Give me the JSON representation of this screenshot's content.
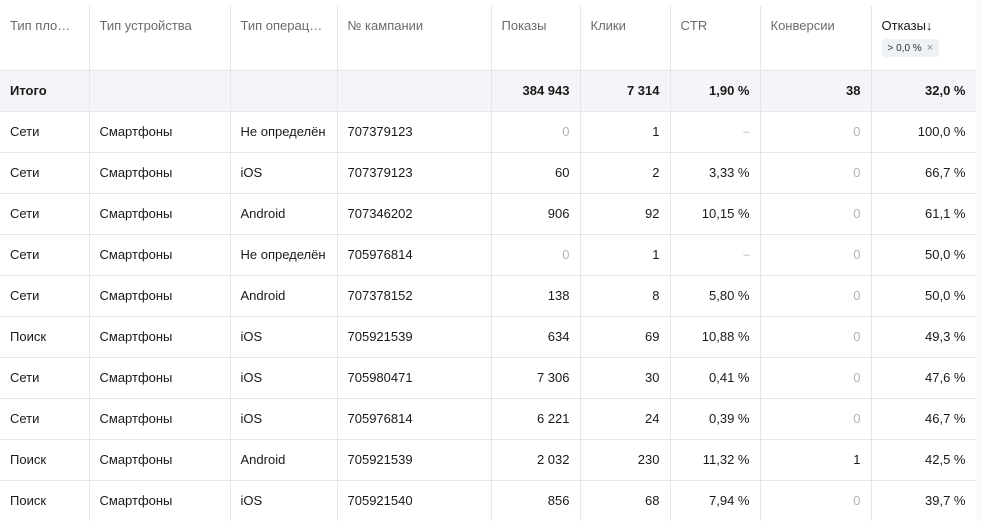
{
  "columns": [
    {
      "label": "Тип площ…"
    },
    {
      "label": "Тип устройства"
    },
    {
      "label": "Тип операци…"
    },
    {
      "label": "№ кампании"
    },
    {
      "label": "Показы"
    },
    {
      "label": "Клики"
    },
    {
      "label": "CTR"
    },
    {
      "label": "Конверсии"
    },
    {
      "label": "Отказы↓",
      "filter": "> 0,0 %",
      "filter_close": "×"
    }
  ],
  "total": {
    "label": "Итого",
    "impressions": "384 943",
    "clicks": "7 314",
    "ctr": "1,90 %",
    "conversions": "38",
    "bounce": "32,0 %"
  },
  "rows": [
    {
      "platform": "Сети",
      "device": "Смартфоны",
      "os": "Не определён",
      "campaign": "707379123",
      "impressions": "0",
      "clicks": "1",
      "ctr": "–",
      "conversions": "0",
      "bounce": "100,0 %"
    },
    {
      "platform": "Сети",
      "device": "Смартфоны",
      "os": "iOS",
      "campaign": "707379123",
      "impressions": "60",
      "clicks": "2",
      "ctr": "3,33 %",
      "conversions": "0",
      "bounce": "66,7 %"
    },
    {
      "platform": "Сети",
      "device": "Смартфоны",
      "os": "Android",
      "campaign": "707346202",
      "impressions": "906",
      "clicks": "92",
      "ctr": "10,15 %",
      "conversions": "0",
      "bounce": "61,1 %"
    },
    {
      "platform": "Сети",
      "device": "Смартфоны",
      "os": "Не определён",
      "campaign": "705976814",
      "impressions": "0",
      "clicks": "1",
      "ctr": "–",
      "conversions": "0",
      "bounce": "50,0 %"
    },
    {
      "platform": "Сети",
      "device": "Смартфоны",
      "os": "Android",
      "campaign": "707378152",
      "impressions": "138",
      "clicks": "8",
      "ctr": "5,80 %",
      "conversions": "0",
      "bounce": "50,0 %"
    },
    {
      "platform": "Поиск",
      "device": "Смартфоны",
      "os": "iOS",
      "campaign": "705921539",
      "impressions": "634",
      "clicks": "69",
      "ctr": "10,88 %",
      "conversions": "0",
      "bounce": "49,3 %"
    },
    {
      "platform": "Сети",
      "device": "Смартфоны",
      "os": "iOS",
      "campaign": "705980471",
      "impressions": "7 306",
      "clicks": "30",
      "ctr": "0,41 %",
      "conversions": "0",
      "bounce": "47,6 %"
    },
    {
      "platform": "Сети",
      "device": "Смартфоны",
      "os": "iOS",
      "campaign": "705976814",
      "impressions": "6 221",
      "clicks": "24",
      "ctr": "0,39 %",
      "conversions": "0",
      "bounce": "46,7 %"
    },
    {
      "platform": "Поиск",
      "device": "Смартфоны",
      "os": "Android",
      "campaign": "705921539",
      "impressions": "2 032",
      "clicks": "230",
      "ctr": "11,32 %",
      "conversions": "1",
      "bounce": "42,5 %"
    },
    {
      "platform": "Поиск",
      "device": "Смартфоны",
      "os": "iOS",
      "campaign": "705921540",
      "impressions": "856",
      "clicks": "68",
      "ctr": "7,94 %",
      "conversions": "0",
      "bounce": "39,7 %"
    }
  ]
}
